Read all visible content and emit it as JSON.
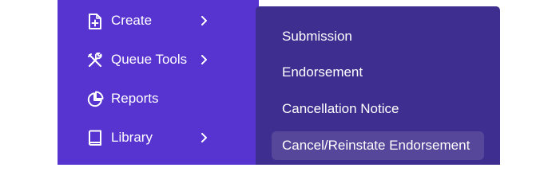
{
  "sidebar": {
    "items": [
      {
        "label": "Create",
        "icon": "file-plus-icon",
        "has_submenu": true
      },
      {
        "label": "Queue Tools",
        "icon": "tools-icon",
        "has_submenu": true
      },
      {
        "label": "Reports",
        "icon": "pie-chart-icon",
        "has_submenu": false
      },
      {
        "label": "Library",
        "icon": "book-icon",
        "has_submenu": true
      }
    ]
  },
  "submenu": {
    "items": [
      {
        "label": "Submission"
      },
      {
        "label": "Endorsement"
      },
      {
        "label": "Cancellation Notice"
      },
      {
        "label": "Cancel/Reinstate Endorsement",
        "highlighted": true
      }
    ]
  },
  "colors": {
    "sidebar_bg": "#5733cf",
    "submenu_bg": "#3d2e8f",
    "submenu_highlight": "#56479b",
    "text": "#ffffff"
  }
}
